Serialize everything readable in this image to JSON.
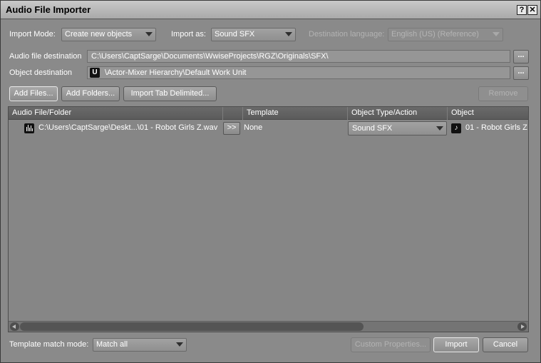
{
  "window": {
    "title": "Audio File Importer",
    "help_label": "?",
    "close_label": "✕"
  },
  "import_mode": {
    "label": "Import Mode:",
    "value": "Create new objects"
  },
  "import_as": {
    "label": "Import as:",
    "value": "Sound SFX"
  },
  "destination_language": {
    "label": "Destination language:",
    "value": "English (US) (Reference)"
  },
  "audio_destination": {
    "label": "Audio file destination",
    "value": "C:\\Users\\CaptSarge\\Documents\\WwiseProjects\\RGZ\\Originals\\SFX\\",
    "browse_label": "..."
  },
  "object_destination": {
    "label": "Object destination",
    "value": "\\Actor-Mixer Hierarchy\\Default Work Unit",
    "browse_label": "...",
    "icon": "work-unit-icon"
  },
  "buttons": {
    "add_files": "Add Files...",
    "add_folders": "Add Folders...",
    "import_tab": "Import Tab Delimited...",
    "remove": "Remove",
    "custom_properties": "Custom Properties...",
    "import": "Import",
    "cancel": "Cancel"
  },
  "table": {
    "columns": [
      "Audio File/Folder",
      "",
      "Template",
      "Object Type/Action",
      "Object"
    ],
    "rows": [
      {
        "file": "C:\\Users\\CaptSarge\\Deskt...\\01 - Robot Girls Z.wav",
        "arrow": ">>",
        "template": "None",
        "object_type": "Sound SFX",
        "object": "01 - Robot Girls Z"
      }
    ]
  },
  "template_match": {
    "label": "Template match mode:",
    "value": "Match all"
  },
  "colors": {
    "background": "#8a8a8a",
    "header": "#5b5b5b",
    "text": "#ffffff"
  }
}
